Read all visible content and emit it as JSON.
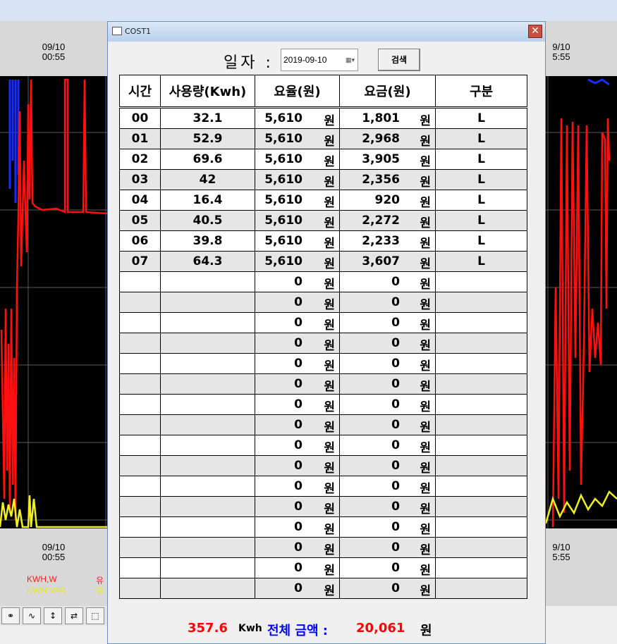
{
  "background": {
    "time_top_left": {
      "date": "09/10",
      "time": "00:55"
    },
    "time_top_right": {
      "date": "9/10",
      "time": "5:55"
    },
    "time_bottom_left": {
      "date": "09/10",
      "time": "00:55"
    },
    "time_bottom_right": {
      "date": "9/10",
      "time": "5:55"
    },
    "legend": [
      {
        "label": "KWH,W",
        "suffix": "유",
        "color": "#ff2020"
      },
      {
        "label": "KWH,VAR",
        "suffix": "무",
        "color": "#e8e820"
      }
    ]
  },
  "dialog": {
    "title": "COST1",
    "date_label": "일자 :",
    "date_value": "2019-09-10",
    "search_label": "검색",
    "headers": [
      "시간",
      "사용량(Kwh)",
      "요율(원)",
      "요금(원)",
      "구분"
    ],
    "unit": "원",
    "rows": [
      {
        "hour": "00",
        "usage": "32.1",
        "rate": "5,610",
        "charge": "1,801",
        "type": "L"
      },
      {
        "hour": "01",
        "usage": "52.9",
        "rate": "5,610",
        "charge": "2,968",
        "type": "L"
      },
      {
        "hour": "02",
        "usage": "69.6",
        "rate": "5,610",
        "charge": "3,905",
        "type": "L"
      },
      {
        "hour": "03",
        "usage": "42",
        "rate": "5,610",
        "charge": "2,356",
        "type": "L"
      },
      {
        "hour": "04",
        "usage": "16.4",
        "rate": "5,610",
        "charge": "920",
        "type": "L"
      },
      {
        "hour": "05",
        "usage": "40.5",
        "rate": "5,610",
        "charge": "2,272",
        "type": "L"
      },
      {
        "hour": "06",
        "usage": "39.8",
        "rate": "5,610",
        "charge": "2,233",
        "type": "L"
      },
      {
        "hour": "07",
        "usage": "64.3",
        "rate": "5,610",
        "charge": "3,607",
        "type": "L"
      },
      {
        "hour": "",
        "usage": "",
        "rate": "0",
        "charge": "0",
        "type": ""
      },
      {
        "hour": "",
        "usage": "",
        "rate": "0",
        "charge": "0",
        "type": ""
      },
      {
        "hour": "",
        "usage": "",
        "rate": "0",
        "charge": "0",
        "type": ""
      },
      {
        "hour": "",
        "usage": "",
        "rate": "0",
        "charge": "0",
        "type": ""
      },
      {
        "hour": "",
        "usage": "",
        "rate": "0",
        "charge": "0",
        "type": ""
      },
      {
        "hour": "",
        "usage": "",
        "rate": "0",
        "charge": "0",
        "type": ""
      },
      {
        "hour": "",
        "usage": "",
        "rate": "0",
        "charge": "0",
        "type": ""
      },
      {
        "hour": "",
        "usage": "",
        "rate": "0",
        "charge": "0",
        "type": ""
      },
      {
        "hour": "",
        "usage": "",
        "rate": "0",
        "charge": "0",
        "type": ""
      },
      {
        "hour": "",
        "usage": "",
        "rate": "0",
        "charge": "0",
        "type": ""
      },
      {
        "hour": "",
        "usage": "",
        "rate": "0",
        "charge": "0",
        "type": ""
      },
      {
        "hour": "",
        "usage": "",
        "rate": "0",
        "charge": "0",
        "type": ""
      },
      {
        "hour": "",
        "usage": "",
        "rate": "0",
        "charge": "0",
        "type": ""
      },
      {
        "hour": "",
        "usage": "",
        "rate": "0",
        "charge": "0",
        "type": ""
      },
      {
        "hour": "",
        "usage": "",
        "rate": "0",
        "charge": "0",
        "type": ""
      },
      {
        "hour": "",
        "usage": "",
        "rate": "0",
        "charge": "0",
        "type": ""
      }
    ],
    "summary": {
      "total_usage": "357.6",
      "usage_unit": "Kwh",
      "total_label": "전체 금액 :",
      "total_amount": "20,061",
      "amount_unit": "원"
    },
    "colors": {
      "total_usage": "#ff0000",
      "total_label": "#0000ff",
      "total_amount": "#ff0000"
    }
  }
}
